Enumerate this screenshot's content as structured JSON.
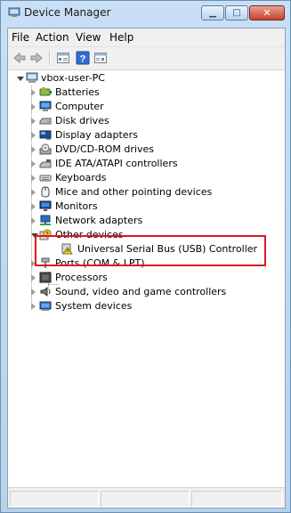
{
  "window": {
    "title": "Device Manager"
  },
  "menu": [
    "File",
    "Action",
    "View",
    "Help"
  ],
  "icons": {
    "app": "device-manager-icon",
    "toolbar": [
      "back-arrow-icon",
      "forward-arrow-icon",
      "properties-icon",
      "help-icon",
      "view-icon"
    ]
  },
  "tree": {
    "root": "vbox-user-PC",
    "items": [
      {
        "label": "Batteries",
        "icon": "battery-icon"
      },
      {
        "label": "Computer",
        "icon": "computer-icon"
      },
      {
        "label": "Disk drives",
        "icon": "disk-drive-icon"
      },
      {
        "label": "Display adapters",
        "icon": "display-adapter-icon"
      },
      {
        "label": "DVD/CD-ROM drives",
        "icon": "dvd-drive-icon"
      },
      {
        "label": "IDE ATA/ATAPI controllers",
        "icon": "ide-controller-icon"
      },
      {
        "label": "Keyboards",
        "icon": "keyboard-icon"
      },
      {
        "label": "Mice and other pointing devices",
        "icon": "mouse-icon"
      },
      {
        "label": "Monitors",
        "icon": "monitor-icon"
      },
      {
        "label": "Network adapters",
        "icon": "network-adapter-icon"
      },
      {
        "label": "Other devices",
        "icon": "unknown-device-icon"
      },
      {
        "label": "Universal Serial Bus (USB) Controller",
        "icon": "warning-device-icon"
      },
      {
        "label": "Ports (COM & LPT)",
        "icon": "port-icon"
      },
      {
        "label": "Processors",
        "icon": "processor-icon"
      },
      {
        "label": "Sound, video and game controllers",
        "icon": "sound-icon"
      },
      {
        "label": "System devices",
        "icon": "system-devices-icon"
      }
    ]
  },
  "colors": {
    "highlight_border": "#e0161b",
    "close_button": "#c6432b"
  }
}
